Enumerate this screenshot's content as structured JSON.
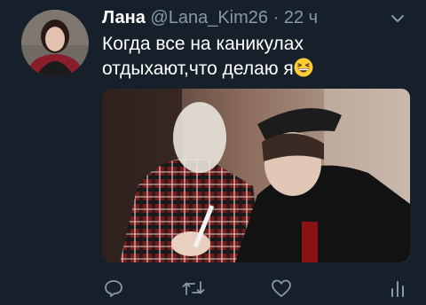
{
  "tweet": {
    "display_name": "Лана",
    "handle": "@Lana_Kim26",
    "separator": "·",
    "time": "22 ч",
    "text": "Когда все на каникулах отдыхают,что делаю я"
  },
  "icons": {
    "avatar": "user-avatar",
    "more": "chevron-down-icon",
    "emoji": "grinning-squinting-face-emoji",
    "reply": "reply-icon",
    "retweet": "retweet-icon",
    "like": "heart-icon",
    "analytics": "analytics-icon"
  },
  "colors": {
    "background": "#15202b",
    "secondary_text": "#8899a6"
  }
}
